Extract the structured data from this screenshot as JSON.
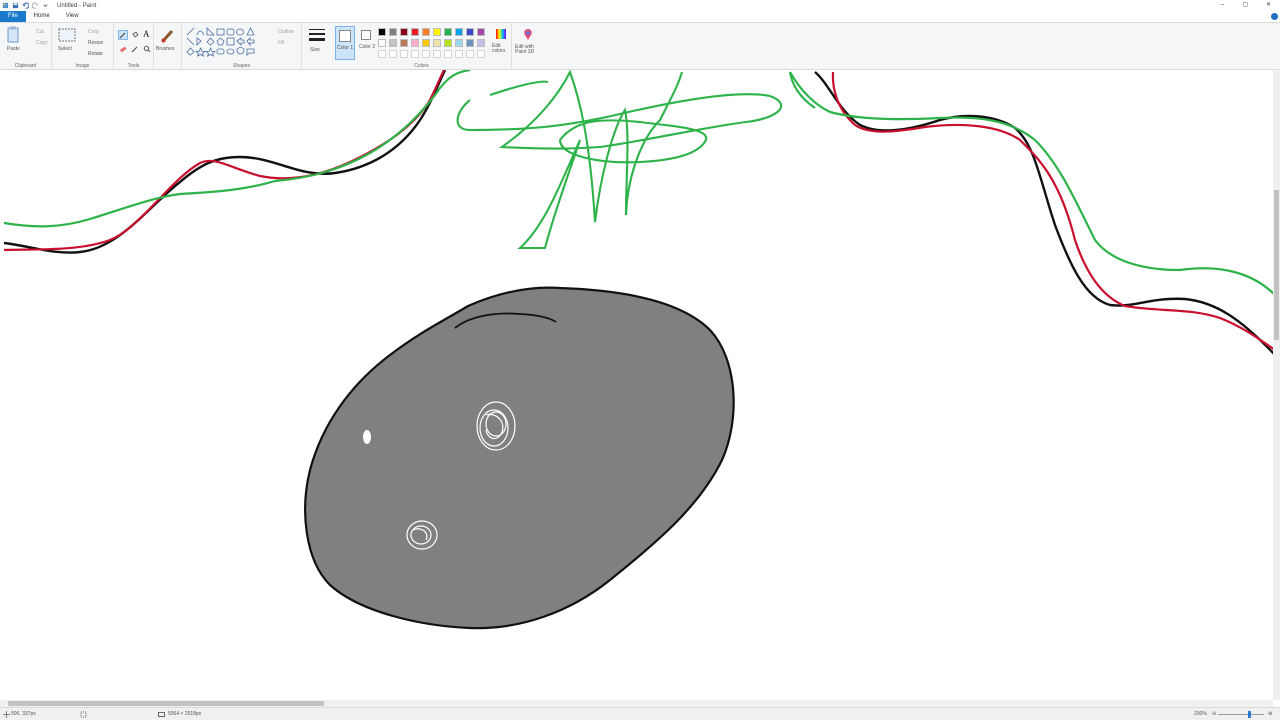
{
  "window": {
    "title": "Untitled - Paint",
    "controls": [
      "–",
      "▢",
      "✕"
    ]
  },
  "tabs": [
    {
      "label": "File"
    },
    {
      "label": "Home"
    },
    {
      "label": "View"
    }
  ],
  "ribbon": {
    "clipboard": {
      "paste": "Paste",
      "cut": "Cut",
      "copy": "Copy",
      "group": "Clipboard"
    },
    "image": {
      "select": "Select",
      "crop": "Crop",
      "resize": "Resize",
      "rotate": "Rotate",
      "group": "Image"
    },
    "tools": {
      "group": "Tools"
    },
    "brushes": {
      "label": "Brushes"
    },
    "shapes": {
      "outline": "Outline",
      "fill": "Fill",
      "group": "Shapes"
    },
    "size": {
      "label": "Size"
    },
    "colors": {
      "color1": "Color 1",
      "color2": "Color 2",
      "edit_colors": "Edit colors",
      "group": "Colors",
      "palette_row1": [
        "#000000",
        "#7f7f7f",
        "#880015",
        "#ed1c24",
        "#ff7f27",
        "#fff200",
        "#22b14c",
        "#00a2e8",
        "#3f48cc",
        "#a349a4"
      ],
      "palette_row2": [
        "#ffffff",
        "#c3c3c3",
        "#b97a57",
        "#ffaec9",
        "#ffc90e",
        "#efe4b0",
        "#b5e61d",
        "#99d9ea",
        "#7092be",
        "#c8bfe7"
      ]
    },
    "paint3d": {
      "label": "Edit with Paint 3D"
    }
  },
  "status": {
    "cursor_position": "506, 337px",
    "canvas_size": "5064 × 2518px",
    "zoom": "200%"
  }
}
